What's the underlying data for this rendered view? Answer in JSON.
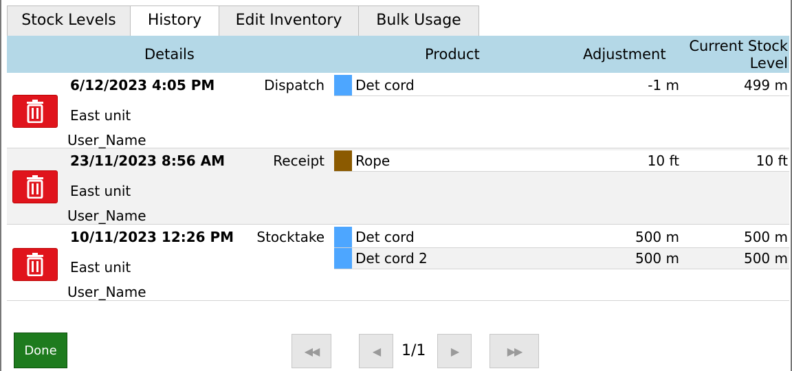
{
  "tabs": [
    {
      "label": "Stock Levels"
    },
    {
      "label": "History"
    },
    {
      "label": "Edit Inventory"
    },
    {
      "label": "Bulk Usage"
    }
  ],
  "active_tab": "History",
  "columns": {
    "details": "Details",
    "product": "Product",
    "adjustment": "Adjustment",
    "current": "Current Stock Level"
  },
  "records": [
    {
      "date": "6/12/2023 4:05 PM",
      "type": "Dispatch",
      "location": "East unit",
      "user": "User_Name",
      "items": [
        {
          "product": "Det cord",
          "adjustment": "-1 m",
          "current": "499 m",
          "color": "#4da6ff"
        }
      ]
    },
    {
      "date": "23/11/2023 8:56 AM",
      "type": "Receipt",
      "location": "East unit",
      "user": "User_Name",
      "items": [
        {
          "product": "Rope",
          "adjustment": "10 ft",
          "current": "10 ft",
          "color": "#8b5a00"
        }
      ]
    },
    {
      "date": "10/11/2023 12:26 PM",
      "type": "Stocktake",
      "location": "East unit",
      "user": "User_Name",
      "items": [
        {
          "product": "Det cord",
          "adjustment": "500 m",
          "current": "500 m",
          "color": "#4da6ff"
        },
        {
          "product": "Det cord 2",
          "adjustment": "500 m",
          "current": "500 m",
          "color": "#4da6ff"
        }
      ]
    }
  ],
  "footer": {
    "done_label": "Done",
    "page_label": "1/1",
    "first_icon": "double-left-arrow-icon",
    "prev_icon": "left-arrow-icon",
    "next_icon": "right-arrow-icon",
    "last_icon": "double-right-arrow-icon"
  },
  "colors": {
    "header_bg": "#b4d8e7",
    "delete_button": "#e0141c",
    "done_button": "#1e7b1e"
  }
}
